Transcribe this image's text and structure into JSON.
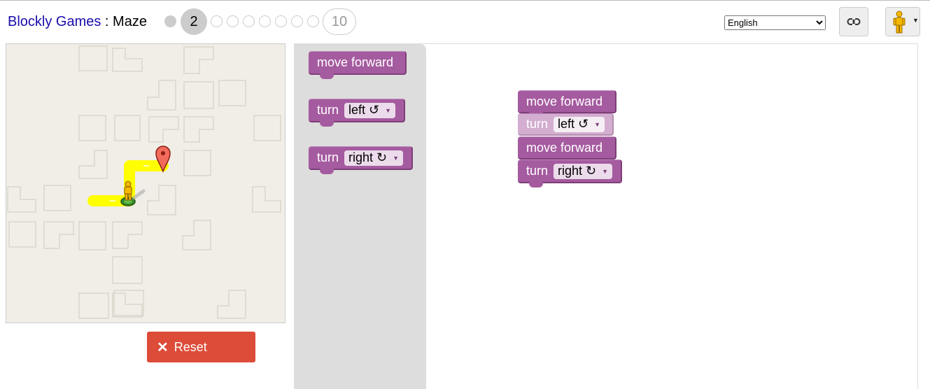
{
  "header": {
    "site": "Blockly Games",
    "separator": " : ",
    "game": "Maze",
    "levels": [
      "1",
      "2",
      "3",
      "4",
      "5",
      "6",
      "7",
      "8",
      "9",
      "10"
    ],
    "current_level": "2",
    "last_level": "10"
  },
  "language": {
    "selected": "English"
  },
  "icons": {
    "link": "link-icon",
    "pegman": "pegman-icon"
  },
  "reset": {
    "label": "Reset"
  },
  "toolbox": {
    "move_forward": "move forward",
    "turn_left_prefix": "turn",
    "turn_left_value": "left ↺",
    "turn_right_prefix": "turn",
    "turn_right_value": "right ↻"
  },
  "program": {
    "block1": "move forward",
    "block2_prefix": "turn",
    "block2_value": "left ↺",
    "block3": "move forward",
    "block4_prefix": "turn",
    "block4_value": "right ↻"
  },
  "colors": {
    "block": "#a55b9f",
    "block_selected": "#d3aed0",
    "reset": "#dd4b39",
    "path": "#ffff00",
    "maze_bg": "#f1eee7"
  }
}
